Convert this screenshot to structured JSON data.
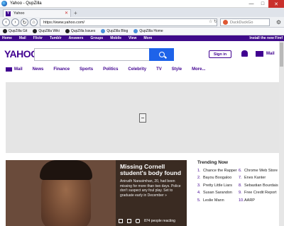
{
  "window": {
    "title": "Yahoo - QupZilla"
  },
  "tab": {
    "favicon": "Y",
    "label": "Yahoo"
  },
  "address": {
    "url": "https://www.yahoo.com/"
  },
  "search_engine": {
    "placeholder": "DuckDuckGo"
  },
  "bookmarks": [
    {
      "label": "QupZilla Git",
      "icon": "github-icon"
    },
    {
      "label": "QupZilla Wiki",
      "icon": "github-icon"
    },
    {
      "label": "QupZilla Issues",
      "icon": "github-icon"
    },
    {
      "label": "QupZilla Blog",
      "icon": "qupzilla-icon"
    },
    {
      "label": "QupZilla Home",
      "icon": "qupzilla-icon"
    }
  ],
  "yahoo_nav": {
    "items": [
      "Home",
      "Mail",
      "Flickr",
      "Tumblr",
      "Answers",
      "Groups",
      "Mobile",
      "View",
      "More"
    ],
    "install": "Install the new Firef"
  },
  "header": {
    "logo": "YAHOO!",
    "signin": "Sign in",
    "mail": "Mail"
  },
  "sections": [
    "Mail",
    "News",
    "Finance",
    "Sports",
    "Politics",
    "Celebrity",
    "TV",
    "Style",
    "More..."
  ],
  "hero": {
    "headline": "Missing Cornell student's body found",
    "summary": "Anirudh Narasimhan, 20, had been missing for more than two days. Police don't suspect any foul play. Set to graduate early in December »",
    "reacting": "874 people reacting"
  },
  "trending": {
    "title": "Trending Now",
    "left": [
      {
        "num": "1.",
        "text": "Chance the Rapper"
      },
      {
        "num": "2.",
        "text": "Bayou Boogaloo"
      },
      {
        "num": "3.",
        "text": "Pretty Little Liars"
      },
      {
        "num": "4.",
        "text": "Susan Sarandon"
      },
      {
        "num": "5.",
        "text": "Leslie Mann"
      }
    ],
    "right": [
      {
        "num": "6.",
        "text": "Chrome Web Store"
      },
      {
        "num": "7.",
        "text": "Enes Kanter"
      },
      {
        "num": "8.",
        "text": "Sebastian Bourdais"
      },
      {
        "num": "9.",
        "text": "Free Credit Report"
      },
      {
        "num": "10.",
        "text": "AARP"
      }
    ]
  },
  "colors": {
    "brand": "#400090",
    "search_button": "#1e63e9",
    "close": "#c9302c"
  }
}
